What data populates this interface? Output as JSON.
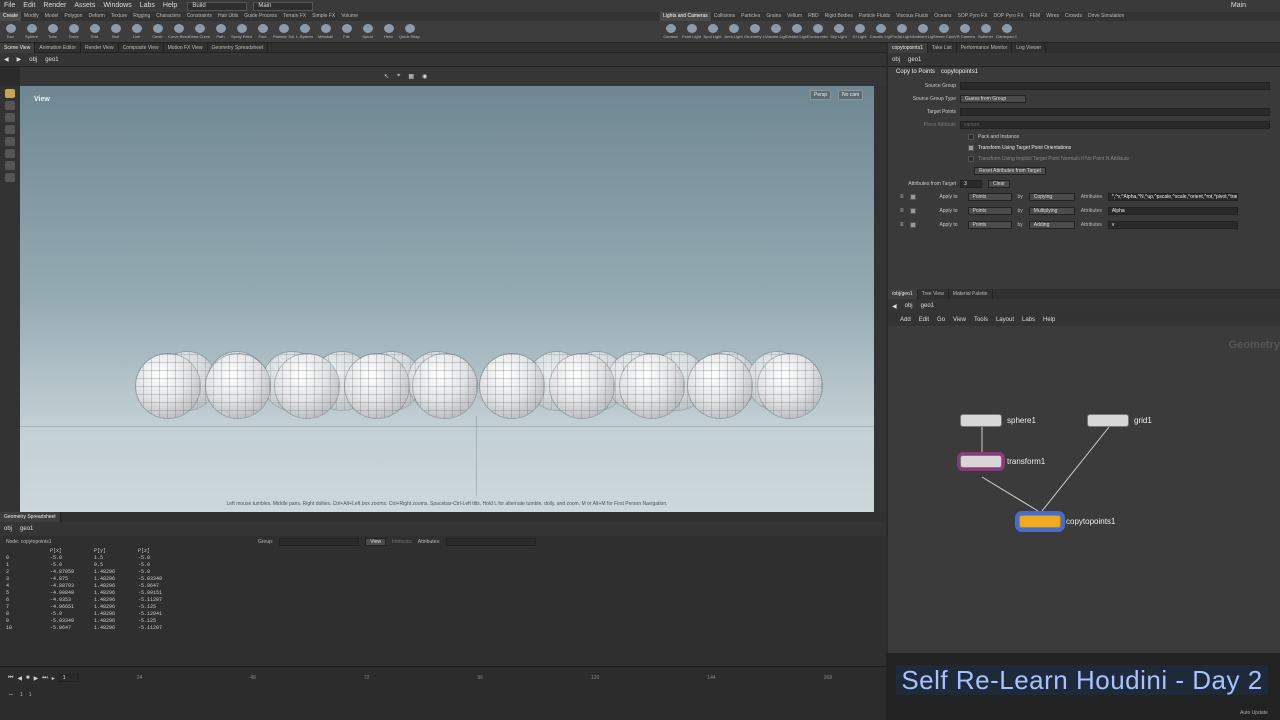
{
  "menu": {
    "items": [
      "File",
      "Edit",
      "Render",
      "Assets",
      "Windows",
      "Labs",
      "Help"
    ],
    "desktop": "Build",
    "context": "Main",
    "window_right": "Main"
  },
  "shelf_tabs_left": [
    "Create",
    "Modify",
    "Model",
    "Polygon",
    "Deform",
    "Texture",
    "Rigging",
    "Characters",
    "Constraints",
    "Hair Utils",
    "Guide Process",
    "Terrain FX",
    "Simple FX",
    "Volume"
  ],
  "shelf_tabs_right": [
    "Lights and Cameras",
    "Collisions",
    "Particles",
    "Grains",
    "Vellum",
    "RBD",
    "Rigid Bodies",
    "Particle Fluids",
    "Viscous Fluids",
    "Oceans",
    "SOP Pyro FX",
    "DOP Pyro FX",
    "FEM",
    "Wires",
    "Crowds",
    "Drive Simulation"
  ],
  "tools_left": [
    "Box",
    "Sphere",
    "Tube",
    "Torus",
    "Grid",
    "Null",
    "Line",
    "Circle",
    "Curve Bezier",
    "Draw Curve",
    "Path",
    "Spray Paint",
    "Font",
    "Platonic Solids",
    "L-System",
    "Metaball",
    "File",
    "Spiral",
    "Helix",
    "Quick Shapes"
  ],
  "tools_right": [
    "Camera",
    "Point Light",
    "Spot Light",
    "Area Light",
    "Geometry Light",
    "Volume Light",
    "Distant Light",
    "Environment Light",
    "Sky Light",
    "GI Light",
    "Caustic Light",
    "Portal Light",
    "Ambient Light",
    "Stereo Camera",
    "VR Camera",
    "Switcher",
    "Gamepad Camera"
  ],
  "pane_tabs_left": [
    "Scene View",
    "Animation Editor",
    "Render View",
    "Composite View",
    "Motion FX View",
    "Geometry Spreadsheet"
  ],
  "pane_tabs_right": [
    "copytopoints1",
    "Take List",
    "Performance Monitor",
    "Log Viewer"
  ],
  "path": {
    "root": "obj",
    "node": "geo1"
  },
  "viewport": {
    "label": "View",
    "persp": "Persp",
    "cam": "No cam",
    "hint": "Left mouse tumbles. Middle pans. Right dollies. Ctrl+Alt+Left box zooms. Ctrl+Right zooms. Spacebar-Ctrl-Left tilts. Hold L for alternate tumble, dolly, and zoom. M or Alt+M for First Person Navigation."
  },
  "params": {
    "node_type": "Copy to Points",
    "node_name": "copytopoints1",
    "source_group_label": "Source Group",
    "source_group_type_label": "Source Group Type",
    "source_group_type_value": "Guess from Group",
    "target_points_label": "Target Points",
    "piece_attribute_label": "Piece Attribute",
    "piece_attribute_value": "variant",
    "pack_and_instance": "Pack and Instance",
    "transform_orient": "Transform Using Target Point Orientations",
    "implicit_normals": "Transform Using Implicit Target Point Normals If No Point N Attribute",
    "reset_button": "Reset Attributes from Target",
    "attrs_from_target_label": "Attributes from Target",
    "attrs_from_target_value": "3",
    "clear_button": "Clear",
    "rules": [
      {
        "apply_label": "Apply to",
        "apply_value": "Points",
        "by_label": "by",
        "mode": "Copying",
        "attr_label": "Attributes",
        "attr_value": "*,^v,^Alpha,^N,^up,^pscale,^scale,^orient,^rot,^pivot,^trans,^transform"
      },
      {
        "apply_label": "Apply to",
        "apply_value": "Points",
        "by_label": "by",
        "mode": "Multiplying",
        "attr_label": "Attributes",
        "attr_value": "Alpha"
      },
      {
        "apply_label": "Apply to",
        "apply_value": "Points",
        "by_label": "by",
        "mode": "Adding",
        "attr_label": "Attributes",
        "attr_value": "v"
      }
    ]
  },
  "network": {
    "tabs": [
      "/obj/geo1",
      "Tree View",
      "Material Palette"
    ],
    "menu": [
      "Add",
      "Edit",
      "Go",
      "View",
      "Tools",
      "Layout",
      "Labs",
      "Help"
    ],
    "watermark": "Geometry",
    "nodes": {
      "sphere": "sphere1",
      "grid": "grid1",
      "transform": "transform1",
      "copy": "copytopoints1"
    }
  },
  "spreadsheet": {
    "tab": "Geometry Spreadsheet",
    "node_label": "Node: copytopoints1",
    "group_label": "Group:",
    "view_label": "View",
    "intrinsics_label": "Intrinsics",
    "attributes_label": "Attributes:",
    "headers": [
      "",
      "P[x]",
      "P[y]",
      "P[z]"
    ],
    "rows": [
      [
        "0",
        "-5.0",
        "1.5",
        "-5.0"
      ],
      [
        "1",
        "-5.0",
        "0.5",
        "-5.0"
      ],
      [
        "2",
        "-4.87059",
        "1.48296",
        "-5.0"
      ],
      [
        "3",
        "-4.875",
        "1.48296",
        "-5.03349"
      ],
      [
        "4",
        "-4.88793",
        "1.48296",
        "-5.0647"
      ],
      [
        "5",
        "-4.90849",
        "1.48296",
        "-5.09151"
      ],
      [
        "6",
        "-4.9353",
        "1.48296",
        "-5.11207"
      ],
      [
        "7",
        "-4.96651",
        "1.48296",
        "-5.125"
      ],
      [
        "8",
        "-5.0",
        "1.48296",
        "-5.12941"
      ],
      [
        "9",
        "-5.03349",
        "1.48296",
        "-5.125"
      ],
      [
        "10",
        "-5.0647",
        "1.48296",
        "-5.11207"
      ]
    ]
  },
  "timeline": {
    "frame": "1",
    "start": "1",
    "end": "1",
    "ticks": [
      "24",
      "48",
      "72",
      "96",
      "120",
      "144",
      "168"
    ]
  },
  "banner": "Self Re-Learn Houdini - Day 2",
  "status_right": "Auto Update"
}
